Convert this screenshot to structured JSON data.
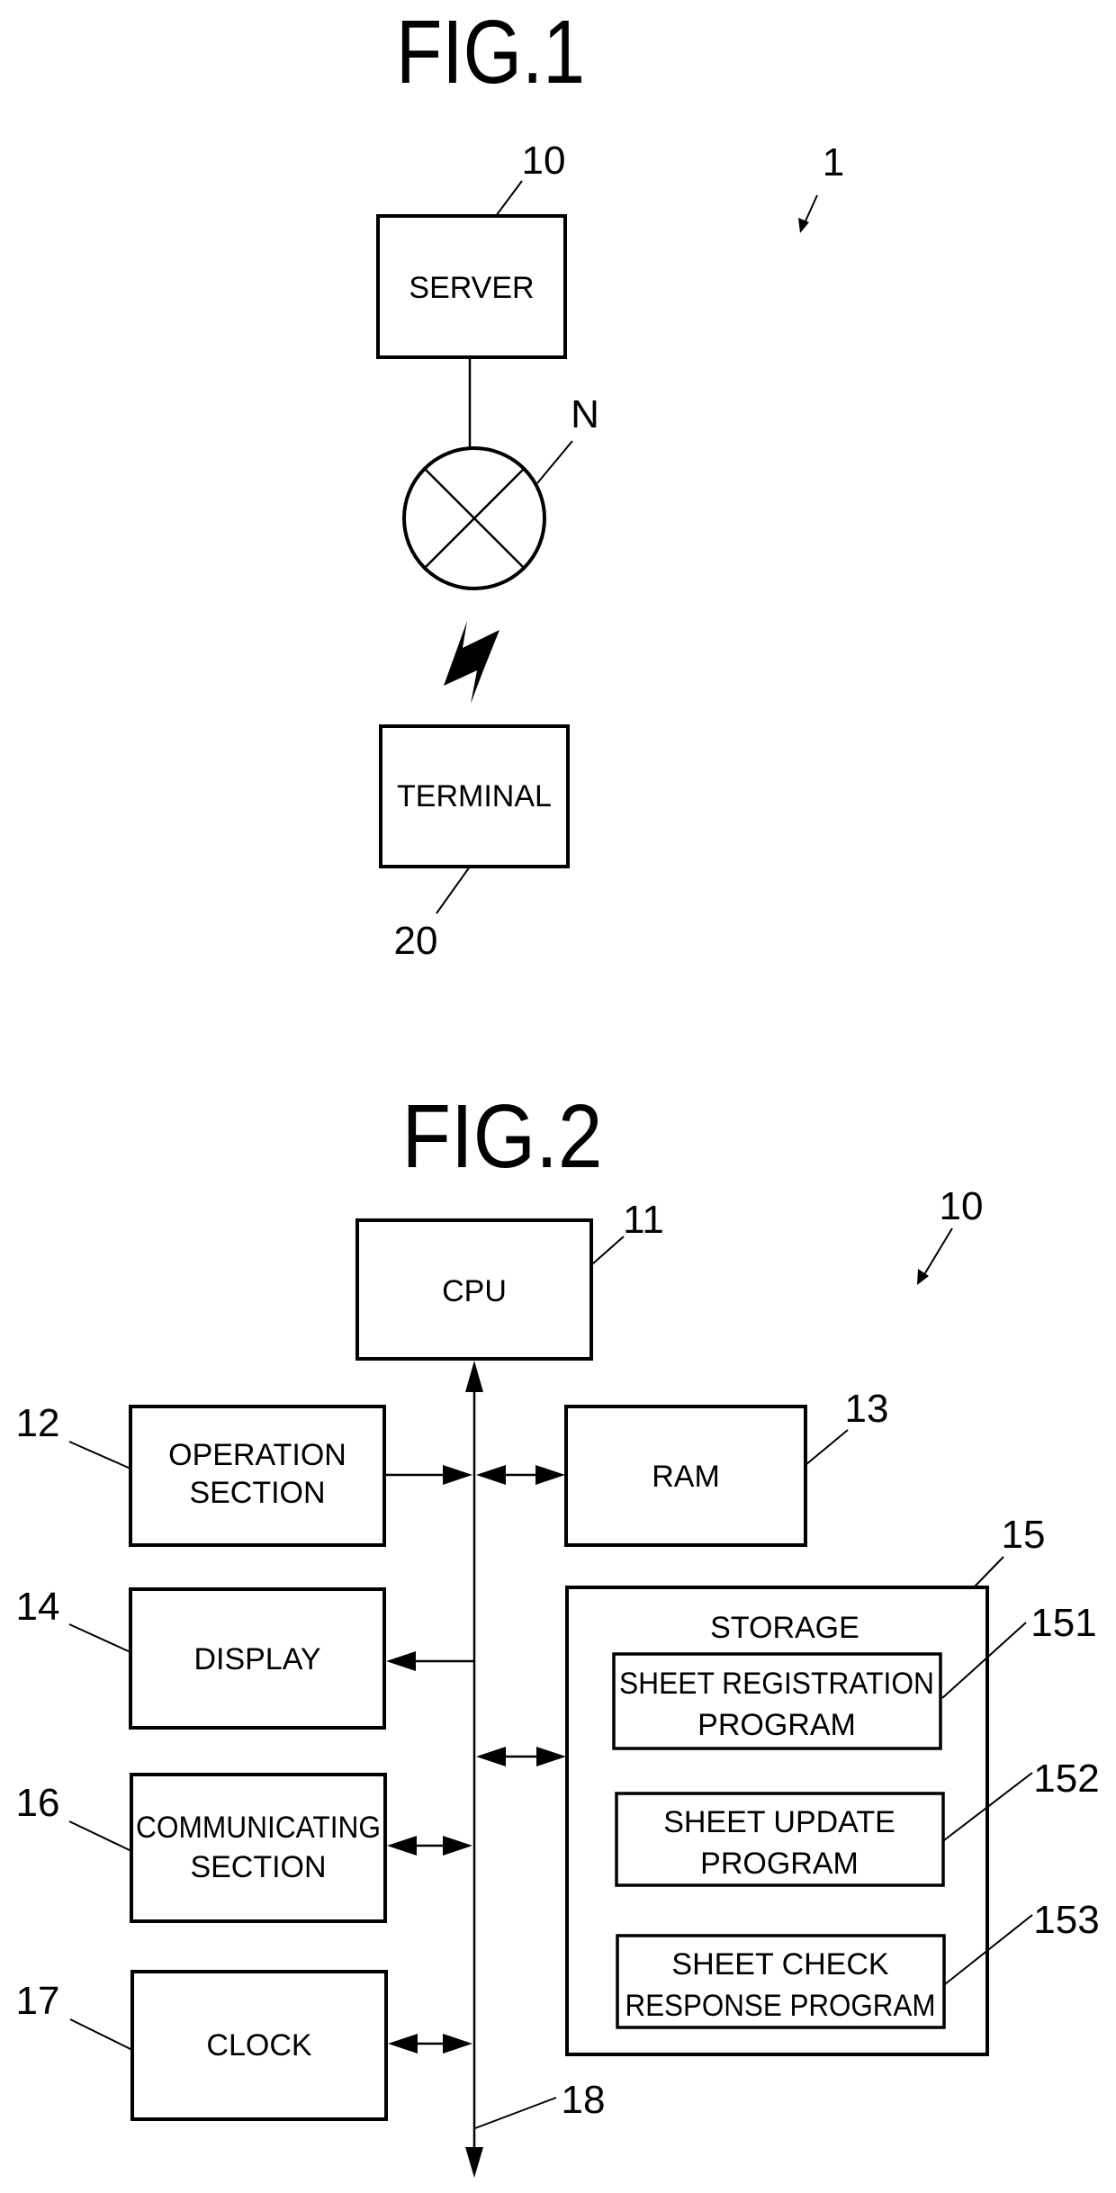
{
  "fig1": {
    "title": "FIG.1",
    "system_ref": "1",
    "server": {
      "label": "SERVER",
      "ref": "10"
    },
    "network": {
      "ref": "N"
    },
    "terminal": {
      "label": "TERMINAL",
      "ref": "20"
    }
  },
  "fig2": {
    "title": "FIG.2",
    "device_ref": "10",
    "cpu": {
      "label": "CPU",
      "ref": "11"
    },
    "operation": {
      "line1": "OPERATION",
      "line2": "SECTION",
      "ref": "12"
    },
    "ram": {
      "label": "RAM",
      "ref": "13"
    },
    "display": {
      "label": "DISPLAY",
      "ref": "14"
    },
    "storage": {
      "label": "STORAGE",
      "ref": "15"
    },
    "programs": [
      {
        "line1": "SHEET REGISTRATION",
        "line2": "PROGRAM",
        "ref": "151"
      },
      {
        "line1": "SHEET UPDATE",
        "line2": "PROGRAM",
        "ref": "152"
      },
      {
        "line1": "SHEET CHECK",
        "line2": "RESPONSE PROGRAM",
        "ref": "153"
      }
    ],
    "communicating": {
      "line1": "COMMUNICATING",
      "line2": "SECTION",
      "ref": "16"
    },
    "clock": {
      "label": "CLOCK",
      "ref": "17"
    },
    "bus": {
      "ref": "18"
    }
  }
}
